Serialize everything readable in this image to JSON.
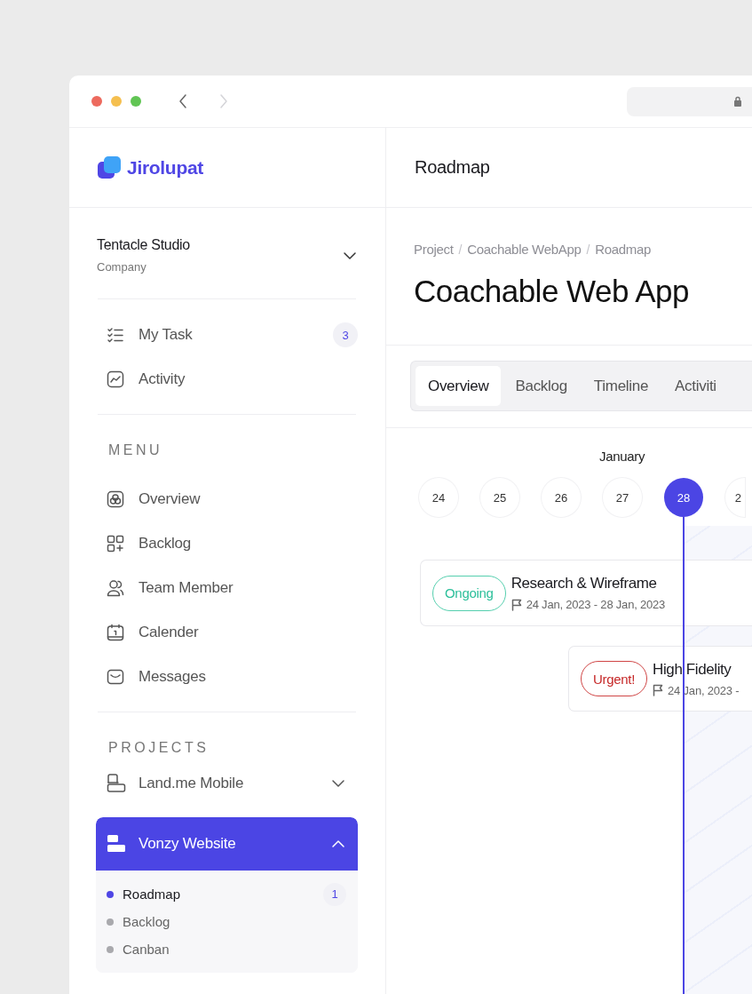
{
  "browser": {
    "nav_buttons": [
      {
        "kind": "back",
        "disabled": false
      },
      {
        "kind": "forward",
        "disabled": true
      }
    ]
  },
  "brand": {
    "name": "Jirolupat"
  },
  "header": {
    "title": "Roadmap"
  },
  "workspace": {
    "name": "Tentacle Studio",
    "type": "Company"
  },
  "quick_links": [
    {
      "label": "My Task",
      "badge": "3"
    },
    {
      "label": "Activity"
    }
  ],
  "menu": {
    "heading": "MENU",
    "items": [
      {
        "label": "Overview"
      },
      {
        "label": "Backlog"
      },
      {
        "label": "Team Member"
      },
      {
        "label": "Calender"
      },
      {
        "label": "Messages"
      }
    ]
  },
  "projects": {
    "heading": "PROJECTS",
    "items": [
      {
        "label": "Land.me Mobile",
        "expanded": false,
        "selected": false
      },
      {
        "label": "Vonzy Website",
        "expanded": true,
        "selected": true,
        "children": [
          {
            "label": "Roadmap",
            "selected": true,
            "badge": "1"
          },
          {
            "label": "Backlog",
            "selected": false
          },
          {
            "label": "Canban",
            "selected": false
          }
        ]
      }
    ]
  },
  "breadcrumb": [
    {
      "kind": "link",
      "label": "Project"
    },
    {
      "kind": "separator",
      "label": "/"
    },
    {
      "kind": "link",
      "label": "Coachable WebApp"
    },
    {
      "kind": "separator",
      "label": "/"
    },
    {
      "kind": "link",
      "label": "Roadmap"
    }
  ],
  "page_title": "Coachable Web App",
  "tabs": [
    {
      "label": "Overview",
      "selected": true
    },
    {
      "label": "Backlog",
      "selected": false
    },
    {
      "label": "Timeline",
      "selected": false
    },
    {
      "label": "Activiti",
      "selected": false
    }
  ],
  "timeline": {
    "month": "January",
    "days": [
      {
        "label": "24",
        "selected": false
      },
      {
        "label": "25",
        "selected": false
      },
      {
        "label": "26",
        "selected": false
      },
      {
        "label": "27",
        "selected": false
      },
      {
        "label": "28",
        "selected": true
      },
      {
        "label": "2",
        "selected": false
      }
    ],
    "tasks": [
      {
        "status": "Ongoing",
        "kind": "ongoing",
        "title": "Research & Wireframe",
        "dates": "24 Jan, 2023 - 28 Jan, 2023"
      },
      {
        "status": "Urgent!",
        "kind": "urgent",
        "title": "High Fidelity",
        "dates": "24 Jan, 2023 -"
      }
    ]
  }
}
